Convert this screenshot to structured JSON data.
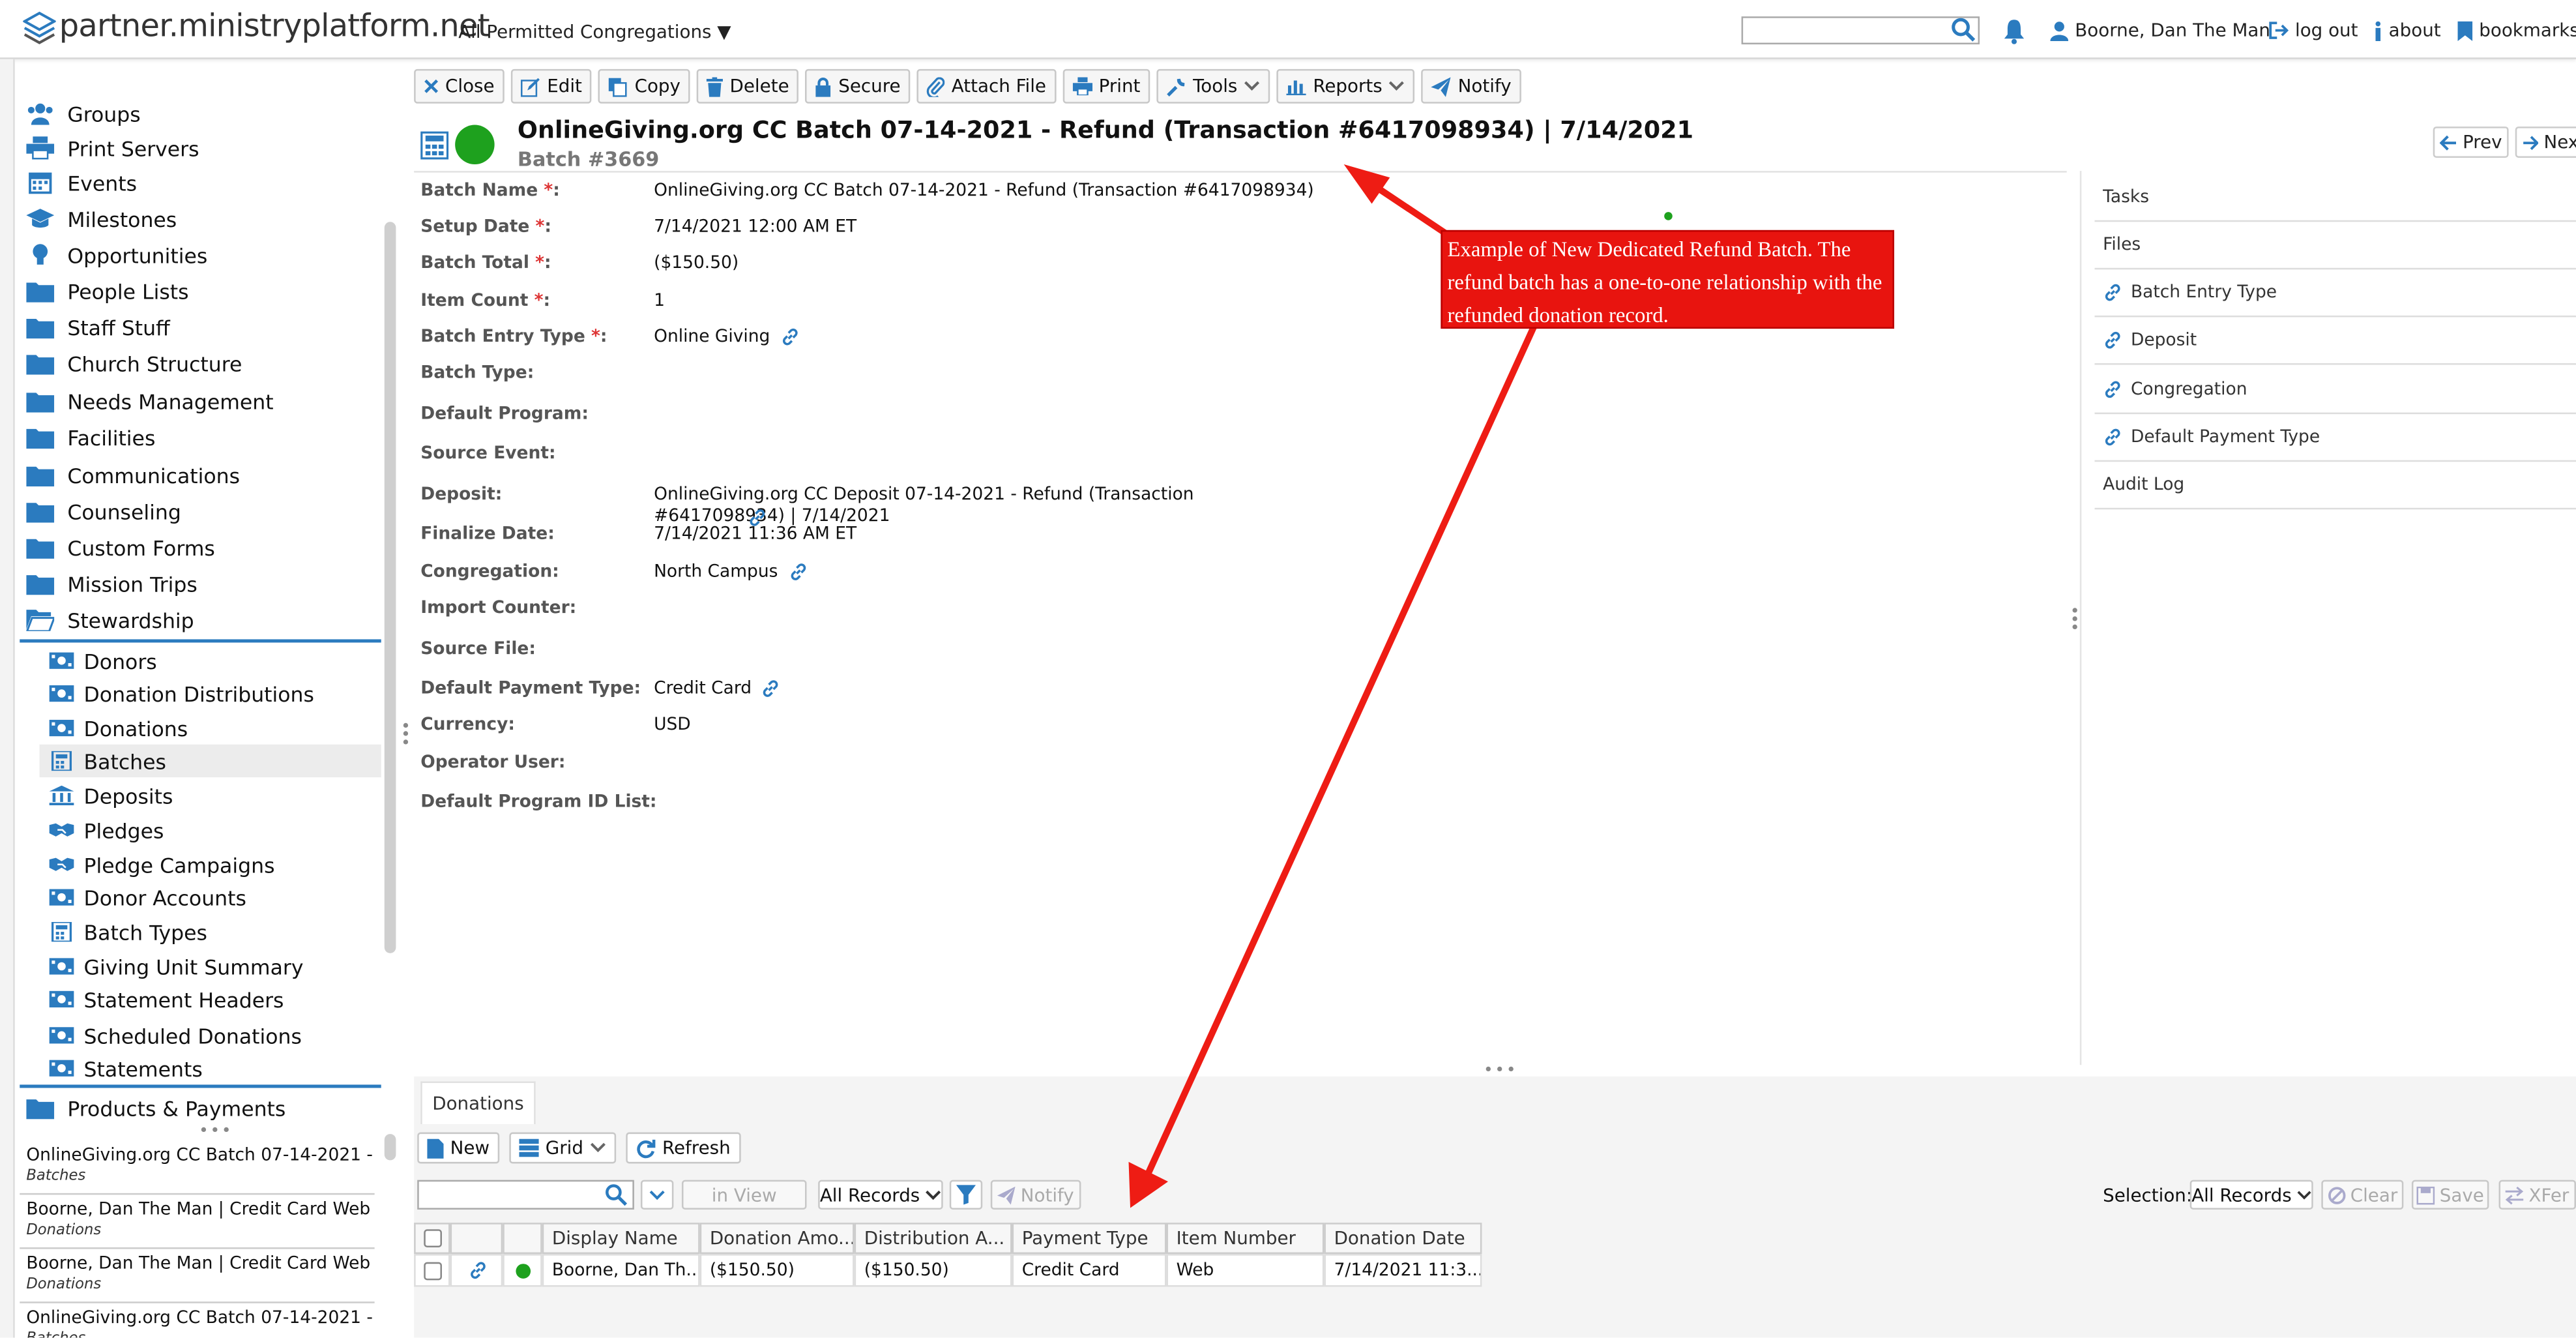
{
  "header": {
    "site_name": "partner.ministryplatform.net",
    "congregation_selector": "All Permitted Congregations ▼",
    "search_placeholder": "",
    "user_name": "Boorne, Dan The Man",
    "logout_label": "log out",
    "about_label": "about",
    "bookmarks_label": "bookmarks"
  },
  "sidebar": {
    "items": [
      {
        "label": "Groups",
        "icon": "groups-icon"
      },
      {
        "label": "Print Servers",
        "icon": "printer-icon"
      },
      {
        "label": "Events",
        "icon": "calendar-icon"
      },
      {
        "label": "Milestones",
        "icon": "graduation-cap-icon"
      },
      {
        "label": "Opportunities",
        "icon": "lightbulb-icon"
      },
      {
        "label": "People Lists",
        "icon": "folder-icon"
      },
      {
        "label": "Staff Stuff",
        "icon": "folder-icon"
      },
      {
        "label": "Church Structure",
        "icon": "folder-icon"
      },
      {
        "label": "Needs Management",
        "icon": "folder-icon"
      },
      {
        "label": "Facilities",
        "icon": "folder-icon"
      },
      {
        "label": "Communications",
        "icon": "folder-icon"
      },
      {
        "label": "Counseling",
        "icon": "folder-icon"
      },
      {
        "label": "Custom Forms",
        "icon": "folder-icon"
      },
      {
        "label": "Mission Trips",
        "icon": "folder-icon"
      },
      {
        "label": "Stewardship",
        "icon": "folder-open-icon"
      }
    ],
    "stewardship_items": [
      {
        "label": "Donors",
        "icon": "money-icon"
      },
      {
        "label": "Donation Distributions",
        "icon": "money-icon"
      },
      {
        "label": "Donations",
        "icon": "money-icon"
      },
      {
        "label": "Batches",
        "icon": "calculator-icon",
        "active": true
      },
      {
        "label": "Deposits",
        "icon": "bank-icon"
      },
      {
        "label": "Pledges",
        "icon": "handshake-icon"
      },
      {
        "label": "Pledge Campaigns",
        "icon": "handshake-icon"
      },
      {
        "label": "Donor Accounts",
        "icon": "money-icon"
      },
      {
        "label": "Batch Types",
        "icon": "calculator-icon"
      },
      {
        "label": "Giving Unit Summary",
        "icon": "money-icon"
      },
      {
        "label": "Statement Headers",
        "icon": "money-icon"
      },
      {
        "label": "Scheduled Donations",
        "icon": "money-icon"
      },
      {
        "label": "Statements",
        "icon": "money-icon"
      }
    ],
    "after_items": [
      {
        "label": "Products & Payments",
        "icon": "folder-icon"
      }
    ],
    "recent": [
      {
        "title": "OnlineGiving.org CC Batch 07-14-2021 - ...",
        "type": "Batches"
      },
      {
        "title": "Boorne, Dan The Man | Credit Card Web |...",
        "type": "Donations"
      },
      {
        "title": "Boorne, Dan The Man | Credit Card Web |...",
        "type": "Donations"
      },
      {
        "title": "OnlineGiving.org CC Batch 07-14-2021 - ...",
        "type": "Batches"
      }
    ]
  },
  "toolbar": {
    "close": "Close",
    "edit": "Edit",
    "copy": "Copy",
    "delete": "Delete",
    "secure": "Secure",
    "attach_file": "Attach File",
    "print": "Print",
    "tools": "Tools",
    "reports": "Reports",
    "notify": "Notify"
  },
  "record": {
    "title": "OnlineGiving.org CC Batch 07-14-2021 - Refund (Transaction #6417098934) | 7/14/2021",
    "subtitle": "Batch #3669",
    "prev_label": "Prev",
    "next_label": "Next",
    "status_color": "#1ea11e"
  },
  "fields": [
    {
      "label": "Batch Name",
      "required": true,
      "value": "OnlineGiving.org CC Batch 07-14-2021 - Refund (Transaction #6417098934)",
      "link": false
    },
    {
      "label": "Setup Date",
      "required": true,
      "value": "7/14/2021 12:00 AM ET",
      "link": false
    },
    {
      "label": "Batch Total",
      "required": true,
      "value": "($150.50)",
      "link": false
    },
    {
      "label": "Item Count",
      "required": true,
      "value": "1",
      "link": false
    },
    {
      "label": "Batch Entry Type",
      "required": true,
      "value": "Online Giving",
      "link": true
    },
    {
      "label": "Batch Type:",
      "required": false,
      "value": "",
      "link": false
    },
    {
      "label": "Default Program:",
      "required": false,
      "value": "",
      "link": false
    },
    {
      "label": "Source Event:",
      "required": false,
      "value": "",
      "link": false
    },
    {
      "label": "Deposit:",
      "required": false,
      "value": "OnlineGiving.org CC Deposit 07-14-2021 - Refund (Transaction #6417098934) | 7/14/2021",
      "link": true
    },
    {
      "label": "Finalize Date:",
      "required": false,
      "value": "7/14/2021 11:36 AM ET",
      "link": false
    },
    {
      "label": "Congregation:",
      "required": false,
      "value": "North Campus",
      "link": true
    },
    {
      "label": "Import Counter:",
      "required": false,
      "value": "",
      "link": false
    },
    {
      "label": "Source File:",
      "required": false,
      "value": "",
      "link": false
    },
    {
      "label": "Default Payment Type:",
      "required": false,
      "value": "Credit Card",
      "link": true
    },
    {
      "label": "Currency:",
      "required": false,
      "value": "USD",
      "link": false
    },
    {
      "label": "Operator User:",
      "required": false,
      "value": "",
      "link": false
    },
    {
      "label": "Default Program ID List:",
      "required": false,
      "value": "",
      "link": false
    }
  ],
  "right_panel": [
    {
      "label": "Tasks",
      "link": false
    },
    {
      "label": "Files",
      "link": false
    },
    {
      "label": "Batch Entry Type",
      "link": true
    },
    {
      "label": "Deposit",
      "link": true
    },
    {
      "label": "Congregation",
      "link": true
    },
    {
      "label": "Default Payment Type",
      "link": true
    },
    {
      "label": "Audit Log",
      "link": false
    }
  ],
  "bottom": {
    "tab": "Donations",
    "new_label": "New",
    "grid_label": "Grid",
    "refresh_label": "Refresh",
    "in_view_label": "in View",
    "all_records_label": "All Records",
    "notify_label": "Notify",
    "selection_label": "Selection:",
    "selection_value": "All Records",
    "clear_label": "Clear",
    "save_label": "Save",
    "xfer_label": "XFer"
  },
  "grid": {
    "columns": [
      "Display Name",
      "Donation Amo...",
      "Distribution A...",
      "Payment Type",
      "Item Number",
      "Donation Date"
    ],
    "rows": [
      {
        "display_name": "Boorne, Dan Th...",
        "donation_amount": "($150.50)",
        "distribution_amount": "($150.50)",
        "payment_type": "Credit Card",
        "item_number": "Web",
        "donation_date": "7/14/2021 11:3..."
      }
    ]
  },
  "annotation": {
    "text": "Example of New Dedicated Refund Batch. The refund batch has a one-to-one relationship with the refunded donation record.",
    "color": "#e8140f"
  },
  "colors": {
    "accent": "#2b7bbf",
    "status_green": "#1ea11e"
  }
}
